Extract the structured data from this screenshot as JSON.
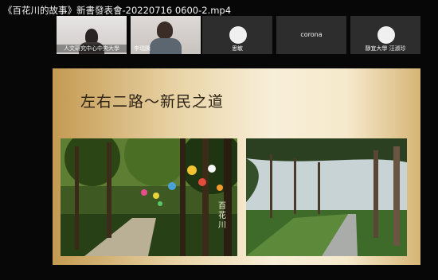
{
  "window": {
    "title": "《百花川的故事》新書發表會-20220716 0600-2.mp4"
  },
  "participants": [
    {
      "name": "人文研究中心中央大學",
      "type": "video"
    },
    {
      "name": "李瑞騰",
      "type": "video"
    },
    {
      "name": "思敏",
      "type": "avatar"
    },
    {
      "name": "corona",
      "type": "name-only"
    },
    {
      "name": "靜宜大學 汪淑珍",
      "type": "avatar"
    }
  ],
  "slide": {
    "title": "左右二路～新民之道",
    "photo_left": {
      "caption": "百花川",
      "icon": "street-trees-photo"
    },
    "photo_right": {
      "icon": "tree-lined-path-photo"
    }
  },
  "colors": {
    "background": "#070707",
    "tile": "#2d2d2d",
    "slide_gold": "#d6b677"
  }
}
